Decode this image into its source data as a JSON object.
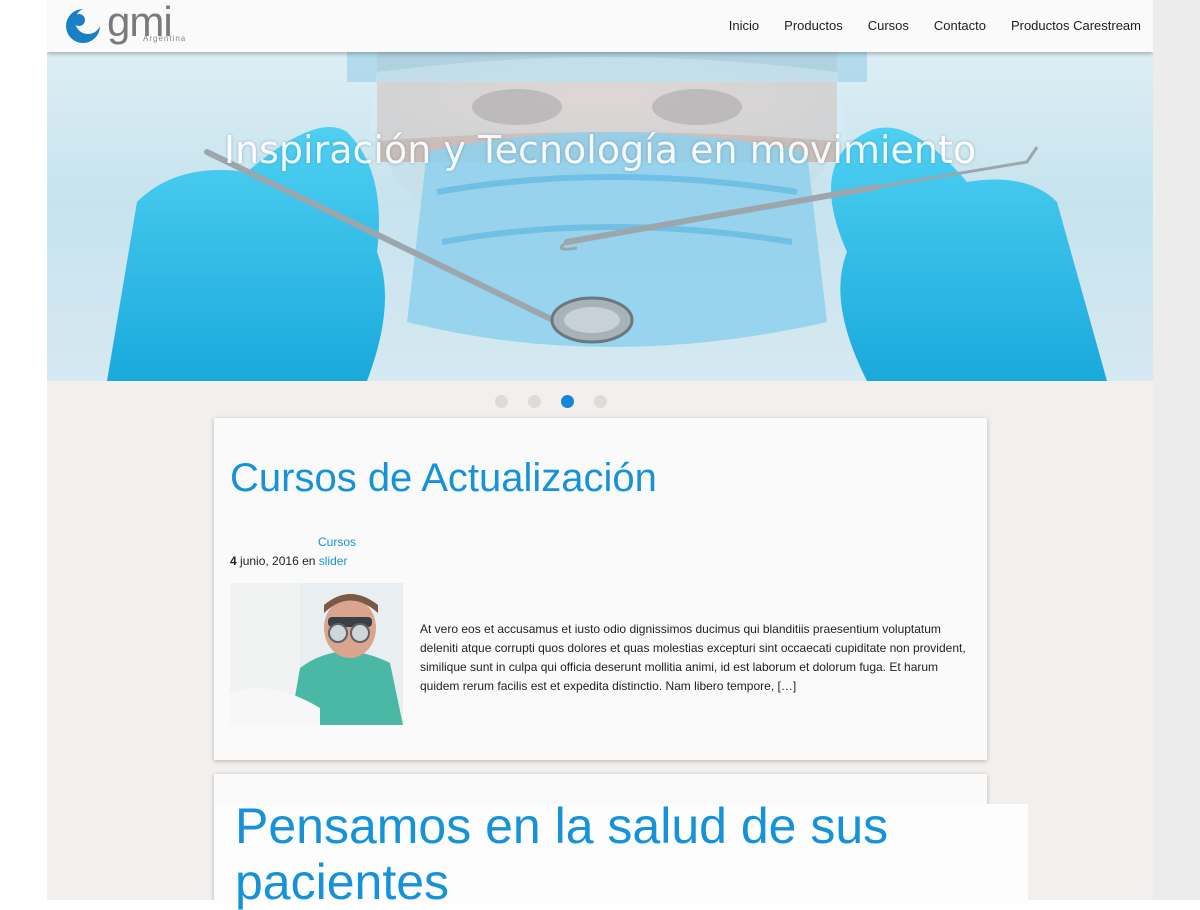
{
  "logo": {
    "word": "gmi",
    "sub": "Argentina"
  },
  "nav": [
    "Inicio",
    "Productos",
    "Cursos",
    "Contacto",
    "Productos Carestream"
  ],
  "slider": {
    "title": "Inspiración y Tecnología en movimiento",
    "dots_count": 4,
    "active_dot": 3
  },
  "post": {
    "title": "Cursos de Actualización",
    "category": "Cursos",
    "date_day": "4",
    "date_rest": " junio, 2016 en ",
    "tag": "slider",
    "excerpt": "At vero eos et accusamus et iusto odio dignissimos ducimus qui blanditiis praesentium voluptatum deleniti atque corrupti quos dolores et quas molestias excepturi sint occaecati cupiditate non provident, similique sunt in culpa qui officia deserunt mollitia animi, id est laborum et dolorum fuga. Et harum quidem rerum facilis est et expedita distinctio. Nam libero tempore, […]"
  },
  "banner": {
    "title": "Pensamos en la salud de sus pacientes"
  },
  "colors": {
    "accent": "#1592d9",
    "dot_active": "#1485d8",
    "background": "#f2efec"
  }
}
